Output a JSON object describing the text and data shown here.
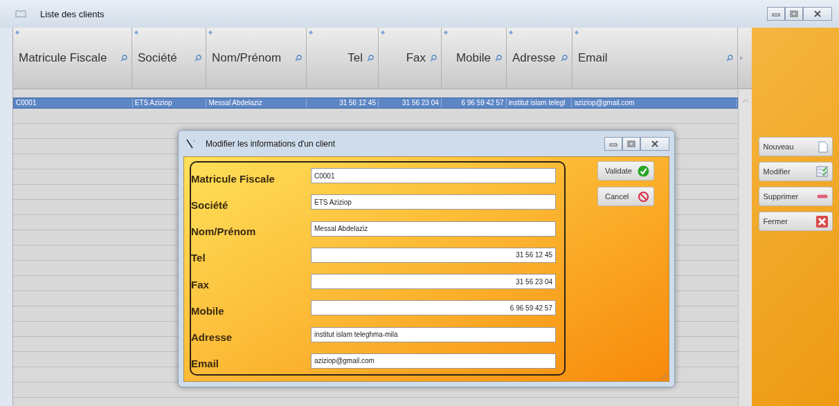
{
  "window": {
    "title": "Liste des clients"
  },
  "table": {
    "columns": [
      {
        "label": "Matricule Fiscale",
        "kind": "text"
      },
      {
        "label": "Société",
        "kind": "text"
      },
      {
        "label": "Nom/Prénom",
        "kind": "text"
      },
      {
        "label": "Tel",
        "kind": "number"
      },
      {
        "label": "Fax",
        "kind": "number"
      },
      {
        "label": "Mobile",
        "kind": "number"
      },
      {
        "label": "Adresse",
        "kind": "text"
      },
      {
        "label": "Email",
        "kind": "text"
      }
    ],
    "rows": [
      {
        "selected": true,
        "cells": [
          "C0001",
          "ETS Aziziop",
          "Messal Abdelaziz",
          "31 56 12 45",
          "31 56 23 04",
          "6 96 59 42 57",
          "institut islam telegl",
          "aziziop@gmail.com"
        ]
      }
    ]
  },
  "side_buttons": [
    {
      "label": "Nouveau",
      "kind": "new"
    },
    {
      "label": "Modifier",
      "kind": "edit"
    },
    {
      "label": "Supprimer",
      "kind": "delete"
    },
    {
      "label": "Fermer",
      "kind": "close"
    }
  ],
  "dialog": {
    "title": "Modifier les informations d'un client",
    "fields": [
      {
        "label": "Matricule Fiscale",
        "value": "C0001",
        "kind": "text"
      },
      {
        "label": "Société",
        "value": "ETS Aziziop",
        "kind": "text"
      },
      {
        "label": "Nom/Prénom",
        "value": "Messal Abdelaziz",
        "kind": "text"
      },
      {
        "label": "Tel",
        "value": "31 56 12 45",
        "kind": "number"
      },
      {
        "label": "Fax",
        "value": "31 56 23 04",
        "kind": "number"
      },
      {
        "label": "Mobile",
        "value": "6 96 59 42 57",
        "kind": "number"
      },
      {
        "label": "Adresse",
        "value": "institut islam teleghma-mila",
        "kind": "text"
      },
      {
        "label": "Email",
        "value": "aziziop@gmail.com",
        "kind": "text"
      }
    ],
    "buttons": [
      {
        "label": "Validate",
        "kind": "ok"
      },
      {
        "label": "Cancel",
        "kind": "cancel"
      }
    ]
  }
}
